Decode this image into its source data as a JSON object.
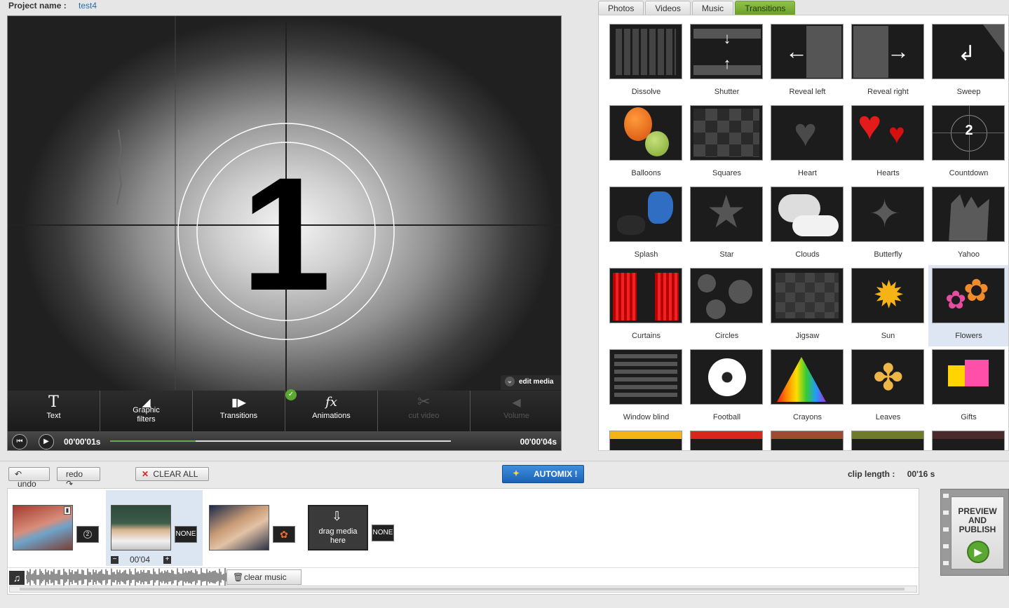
{
  "project": {
    "label": "Project name :",
    "value": "test4"
  },
  "preview": {
    "countdown_number": "1",
    "edit_media": "edit media",
    "tools": [
      {
        "label": "Text",
        "icon": "T",
        "enabled": true
      },
      {
        "label": "Graphic filters",
        "icon": "paint-bucket",
        "enabled": true
      },
      {
        "label": "Transitions",
        "icon": "transition",
        "enabled": true
      },
      {
        "label": "Animations",
        "icon": "fx",
        "enabled": true,
        "checked": true
      },
      {
        "label": "cut video",
        "icon": "scissors",
        "enabled": false
      },
      {
        "label": "Volume",
        "icon": "speaker",
        "enabled": false
      }
    ],
    "time_current": "00'00'01s",
    "time_total": "00'00'04s",
    "progress": 0.25
  },
  "tabs": [
    {
      "label": "Photos",
      "active": false
    },
    {
      "label": "Videos",
      "active": false
    },
    {
      "label": "Music",
      "active": false
    },
    {
      "label": "Transitions",
      "active": true
    }
  ],
  "transitions": [
    {
      "name": "Dissolve"
    },
    {
      "name": "Shutter"
    },
    {
      "name": "Reveal left"
    },
    {
      "name": "Reveal right"
    },
    {
      "name": "Sweep"
    },
    {
      "name": "Balloons"
    },
    {
      "name": "Squares"
    },
    {
      "name": "Heart"
    },
    {
      "name": "Hearts"
    },
    {
      "name": "Countdown"
    },
    {
      "name": "Splash"
    },
    {
      "name": "Star"
    },
    {
      "name": "Clouds"
    },
    {
      "name": "Butterfly"
    },
    {
      "name": "Yahoo"
    },
    {
      "name": "Curtains"
    },
    {
      "name": "Circles"
    },
    {
      "name": "Jigsaw"
    },
    {
      "name": "Sun"
    },
    {
      "name": "Flowers",
      "selected": true
    },
    {
      "name": "Window blind"
    },
    {
      "name": "Football"
    },
    {
      "name": "Crayons"
    },
    {
      "name": "Leaves"
    },
    {
      "name": "Gifts"
    }
  ],
  "countdown_thumb_number": "2",
  "controls": {
    "undo": "undo",
    "redo": "redo",
    "clear_all": "CLEAR ALL",
    "automix": "AUTOMIX !",
    "clip_length_label": "clip length :",
    "clip_length_value": "00'16 s"
  },
  "timeline": {
    "transition1": "2",
    "transition2": "NONE",
    "transition4": "NONE",
    "duration": "00'04",
    "minus": "−",
    "plus": "+",
    "drop_text": "drag media here",
    "clear_music": "clear music"
  },
  "publish": {
    "label": "PREVIEW AND PUBLISH"
  }
}
